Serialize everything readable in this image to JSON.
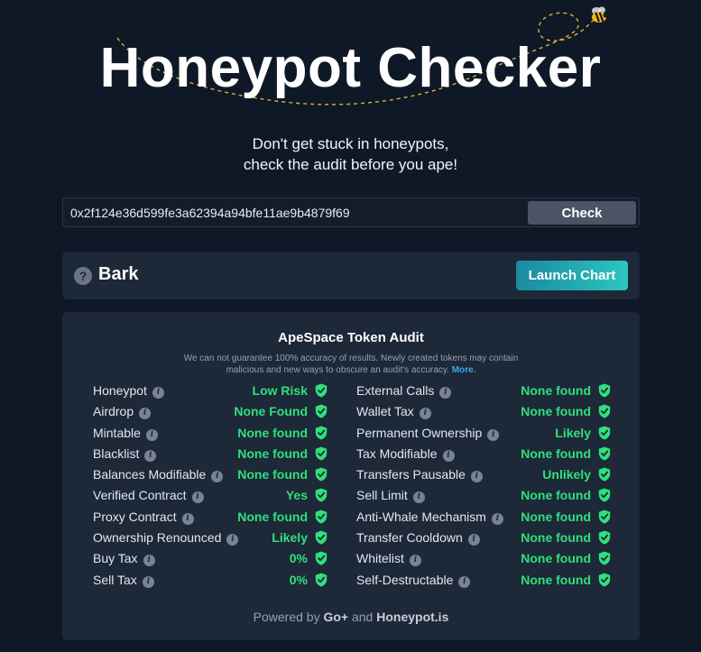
{
  "header": {
    "title": "Honeypot Checker",
    "tagline_line1": "Don't get stuck in honeypots,",
    "tagline_line2": "check the audit before you ape!"
  },
  "search": {
    "value": "0x2f124e36d599fe3a62394a94bfe11ae9b4879f69",
    "button_label": "Check"
  },
  "token": {
    "name": "Bark",
    "icon": "question-mark-icon",
    "launch_label": "Launch Chart"
  },
  "audit": {
    "title": "ApeSpace Token Audit",
    "disclaimer": "We can not guarantee 100% accuracy of results. Newly created tokens may contain malicious and new ways to obscure an audit's accuracy.",
    "more_label": "More.",
    "left": [
      {
        "label": "Honeypot",
        "value": "Low Risk"
      },
      {
        "label": "Airdrop",
        "value": "None Found"
      },
      {
        "label": "Mintable",
        "value": "None found"
      },
      {
        "label": "Blacklist",
        "value": "None found"
      },
      {
        "label": "Balances Modifiable",
        "value": "None found"
      },
      {
        "label": "Verified Contract",
        "value": "Yes"
      },
      {
        "label": "Proxy Contract",
        "value": "None found"
      },
      {
        "label": "Ownership Renounced",
        "value": "Likely"
      },
      {
        "label": "Buy Tax",
        "value": "0%"
      },
      {
        "label": "Sell Tax",
        "value": "0%"
      }
    ],
    "right": [
      {
        "label": "External Calls",
        "value": "None found"
      },
      {
        "label": "Wallet Tax",
        "value": "None found"
      },
      {
        "label": "Permanent Ownership",
        "value": "Likely"
      },
      {
        "label": "Tax Modifiable",
        "value": "None found"
      },
      {
        "label": "Transfers Pausable",
        "value": "Unlikely"
      },
      {
        "label": "Sell Limit",
        "value": "None found"
      },
      {
        "label": "Anti-Whale Mechanism",
        "value": "None found"
      },
      {
        "label": "Transfer Cooldown",
        "value": "None found"
      },
      {
        "label": "Whitelist",
        "value": "None found"
      },
      {
        "label": "Self-Destructable",
        "value": "None found"
      }
    ],
    "powered_prefix": "Powered by",
    "powered_goplus": "Go+",
    "powered_and": "and",
    "powered_honeypot": "Honeypot.is"
  },
  "colors": {
    "background": "#0f1826",
    "card": "#1d2838",
    "safe_green": "#2fe07d",
    "accent_teal": "#2cc6bf"
  }
}
